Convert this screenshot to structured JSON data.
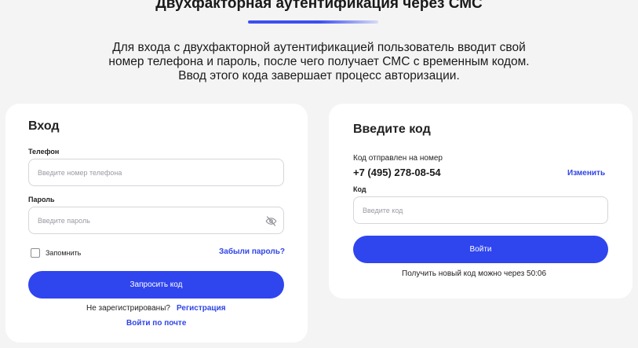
{
  "header": {
    "title": "Двухфакторная аутентификация через СМС",
    "description_lines": [
      "Для входа с двухфакторной аутентификацией пользователь вводит свой",
      "номер телефона и пароль, после чего получает СМС с временным кодом.",
      "Ввод этого кода завершает процесс авторизации."
    ]
  },
  "login": {
    "title": "Вход",
    "phone_label": "Телефон",
    "phone_placeholder": "Введите номер телефона",
    "password_label": "Пароль",
    "password_placeholder": "Введите пароль",
    "remember_label": "Запомнить",
    "forgot_link": "Забыли пароль?",
    "request_button": "Запросить код",
    "not_registered": "Не зарегистрированы?",
    "register_link": "Регистрация",
    "email_login_link": "Войти по почте"
  },
  "code": {
    "title": "Введите код",
    "sent_to_label": "Код отправлен на номер",
    "phone_number": "+7 (495) 278-08-54",
    "change_link": "Изменить",
    "code_label": "Код",
    "code_placeholder": "Введите код",
    "submit_button": "Войти",
    "resend_text": "Получить новый код можно через 50:06"
  },
  "colors": {
    "accent": "#2f45ee",
    "background": "#f4f4f5",
    "card": "#ffffff"
  },
  "icons": {
    "password_visibility": "eye-off-icon"
  }
}
